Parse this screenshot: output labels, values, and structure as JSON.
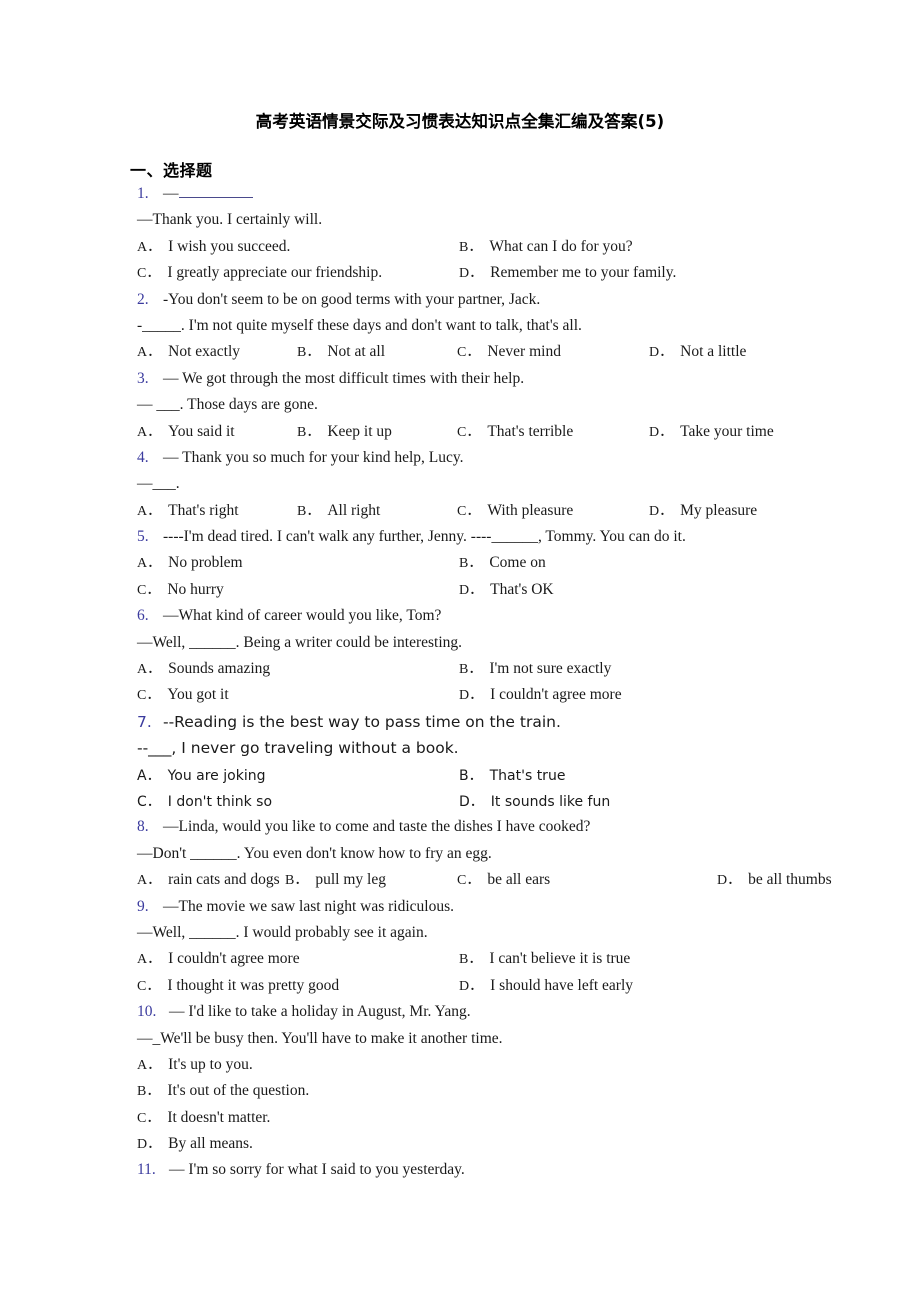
{
  "document": {
    "title": "高考英语情景交际及习惯表达知识点全集汇编及答案(5)",
    "section_heading": "一、选择题",
    "number_color": "#3b3b9e",
    "text_color": "#1a1a1a"
  },
  "questions": [
    {
      "number": "1.",
      "stem_lines": [
        "—",
        "—Thank you. I certainly will."
      ],
      "options": [
        {
          "label": "A．",
          "text": "I wish you succeed."
        },
        {
          "label": "B．",
          "text": "What can I do for you?"
        },
        {
          "label": "C．",
          "text": "I greatly appreciate our friendship."
        },
        {
          "label": "D．",
          "text": "Remember me to your family."
        }
      ],
      "layout": "2col"
    },
    {
      "number": "2.",
      "stem_lines": [
        "-You don't seem to be on good terms with your partner, Jack.",
        "-_____. I'm not quite myself these days and don't want to talk, that's all."
      ],
      "options": [
        {
          "label": "A．",
          "text": "Not exactly"
        },
        {
          "label": "B．",
          "text": "Not at all"
        },
        {
          "label": "C．",
          "text": "Never mind"
        },
        {
          "label": "D．",
          "text": "Not a little"
        }
      ],
      "layout": "4col"
    },
    {
      "number": "3.",
      "stem_lines": [
        "— We got through the most difficult times with their help.",
        "—  ___. Those days are gone."
      ],
      "options": [
        {
          "label": "A．",
          "text": "You said it"
        },
        {
          "label": "B．",
          "text": "Keep it up"
        },
        {
          "label": "C．",
          "text": "That's terrible"
        },
        {
          "label": "D．",
          "text": "Take your time"
        }
      ],
      "layout": "4col"
    },
    {
      "number": "4.",
      "stem_lines": [
        "— Thank you so much for your kind help, Lucy.",
        "—___."
      ],
      "options": [
        {
          "label": "A．",
          "text": "That's right"
        },
        {
          "label": "B．",
          "text": "All right"
        },
        {
          "label": "C．",
          "text": "With pleasure"
        },
        {
          "label": "D．",
          "text": "My pleasure"
        }
      ],
      "layout": "4col"
    },
    {
      "number": "5.",
      "stem_lines": [
        "----I'm dead tired. I can't walk any further, Jenny. ----______, Tommy. You can do it."
      ],
      "options": [
        {
          "label": "A．",
          "text": "No problem"
        },
        {
          "label": "B．",
          "text": "Come on"
        },
        {
          "label": "C．",
          "text": "No hurry"
        },
        {
          "label": "D．",
          "text": "That's OK"
        }
      ],
      "layout": "2col"
    },
    {
      "number": "6.",
      "stem_lines": [
        "—What kind of career would you like, Tom?",
        "—Well, ______. Being a writer could be interesting."
      ],
      "options": [
        {
          "label": "A．",
          "text": "Sounds amazing"
        },
        {
          "label": "B．",
          "text": "I'm not sure exactly"
        },
        {
          "label": "C．",
          "text": "You got it"
        },
        {
          "label": "D．",
          "text": "I couldn't agree more"
        }
      ],
      "layout": "2col"
    },
    {
      "number": "7.",
      "stem_lines": [
        "--Reading is the best way to pass time on the train.",
        "--___, I never go traveling without a book."
      ],
      "options": [
        {
          "label": "A．",
          "text": "You are joking"
        },
        {
          "label": "B．",
          "text": "That's true"
        },
        {
          "label": "C．",
          "text": "I don't think so"
        },
        {
          "label": "D．",
          "text": "It sounds like fun"
        }
      ],
      "layout": "2col-sans"
    },
    {
      "number": "8.",
      "stem_lines": [
        "—Linda, would you like to come and taste the dishes I have cooked?",
        "—Don't ______. You even don't know how to fry an egg."
      ],
      "options": [
        {
          "label": "A．",
          "text": "rain cats and dogs"
        },
        {
          "label": "B．",
          "text": "pull my leg"
        },
        {
          "label": "C．",
          "text": "be all ears"
        },
        {
          "label": "D．",
          "text": "be all thumbs"
        }
      ],
      "layout": "4col-irregular"
    },
    {
      "number": "9.",
      "stem_lines": [
        "—The movie we saw last night was ridiculous.",
        "—Well, ______. I would probably see it again."
      ],
      "options": [
        {
          "label": "A．",
          "text": "I couldn't agree more"
        },
        {
          "label": "B．",
          "text": "I can't believe it is true"
        },
        {
          "label": "C．",
          "text": "I thought it was pretty good"
        },
        {
          "label": "D．",
          "text": "I should have left early"
        }
      ],
      "layout": "2col"
    },
    {
      "number": "10.",
      "stem_lines": [
        "— I'd like to take a holiday in August, Mr. Yang.",
        "—_We'll be busy then. You'll have to make it another time."
      ],
      "options": [
        {
          "label": "A．",
          "text": "It's up to you."
        },
        {
          "label": "B．",
          "text": "It's out of the question."
        },
        {
          "label": "C．",
          "text": "It doesn't matter."
        },
        {
          "label": "D．",
          "text": "By all means."
        }
      ],
      "layout": "1col"
    },
    {
      "number": "11.",
      "stem_lines": [
        "— I'm so sorry for what I said to you yesterday."
      ],
      "options": [],
      "layout": "none"
    }
  ]
}
